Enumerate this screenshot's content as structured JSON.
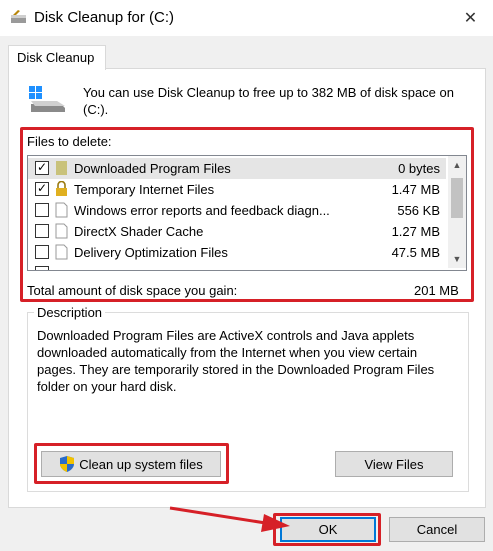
{
  "window": {
    "title": "Disk Cleanup for  (C:)",
    "close_glyph": "✕"
  },
  "tab": {
    "label": "Disk Cleanup"
  },
  "intro": {
    "text": "You can use Disk Cleanup to free up to 382 MB of disk space on (C:)."
  },
  "files": {
    "label": "Files to delete:",
    "items": [
      {
        "checked": true,
        "name": "Downloaded Program Files",
        "size": "0 bytes",
        "icon": "folder-icon",
        "selected": true
      },
      {
        "checked": true,
        "name": "Temporary Internet Files",
        "size": "1.47 MB",
        "icon": "lock-icon"
      },
      {
        "checked": false,
        "name": "Windows error reports and feedback diagn...",
        "size": "556 KB",
        "icon": "file-icon"
      },
      {
        "checked": false,
        "name": "DirectX Shader Cache",
        "size": "1.27 MB",
        "icon": "file-icon"
      },
      {
        "checked": false,
        "name": "Delivery Optimization Files",
        "size": "47.5 MB",
        "icon": "file-icon"
      }
    ],
    "tick_glyph": "✓",
    "scroll_up_glyph": "▲",
    "scroll_down_glyph": "▼"
  },
  "total": {
    "label": "Total amount of disk space you gain:",
    "value": "201 MB"
  },
  "description": {
    "title": "Description",
    "text": "Downloaded Program Files are ActiveX controls and Java applets downloaded automatically from the Internet when you view certain pages. They are temporarily stored in the Downloaded Program Files folder on your hard disk."
  },
  "buttons": {
    "cleanup": "Clean up system files",
    "view_files": "View Files",
    "ok": "OK",
    "cancel": "Cancel"
  },
  "colors": {
    "annotation": "#d62027",
    "focus": "#0078d7"
  }
}
